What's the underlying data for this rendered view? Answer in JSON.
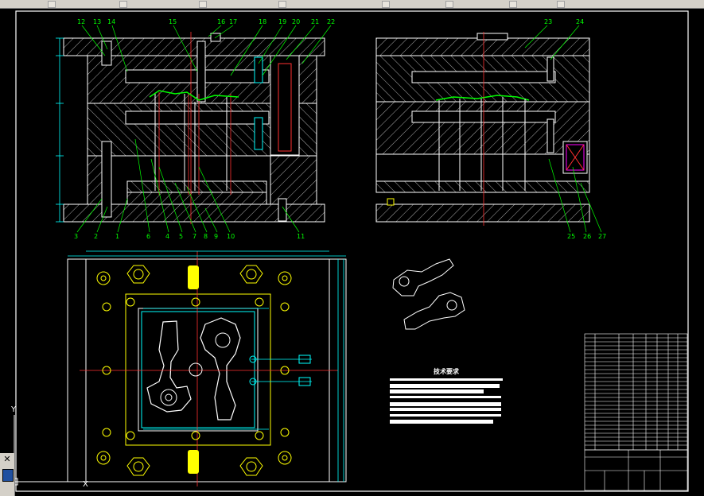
{
  "balloons_front": [
    "12",
    "13",
    "14",
    "15",
    "16",
    "17",
    "18",
    "19",
    "20",
    "21",
    "22"
  ],
  "balloons_front_bottom": [
    "3",
    "2",
    "1",
    "6",
    "4",
    "5",
    "7",
    "8",
    "9",
    "10",
    "11"
  ],
  "balloons_side_top": [
    "23",
    "24"
  ],
  "balloons_side_bottom": [
    "25",
    "26",
    "27"
  ],
  "tech_title": "技术要求",
  "ucs": {
    "y_label": "Y",
    "x_label": "X"
  },
  "colors": {
    "background": "#000000",
    "frame": "#ffffff",
    "balloon": "#00ff00",
    "hatch": "#bfbfbf",
    "center_line": "#ff3030",
    "dimension": "#00ffff",
    "bolt": "#ffff00",
    "toolbar": "#d4d0c8"
  },
  "icons": [
    "close-icon",
    "layout-icon"
  ]
}
